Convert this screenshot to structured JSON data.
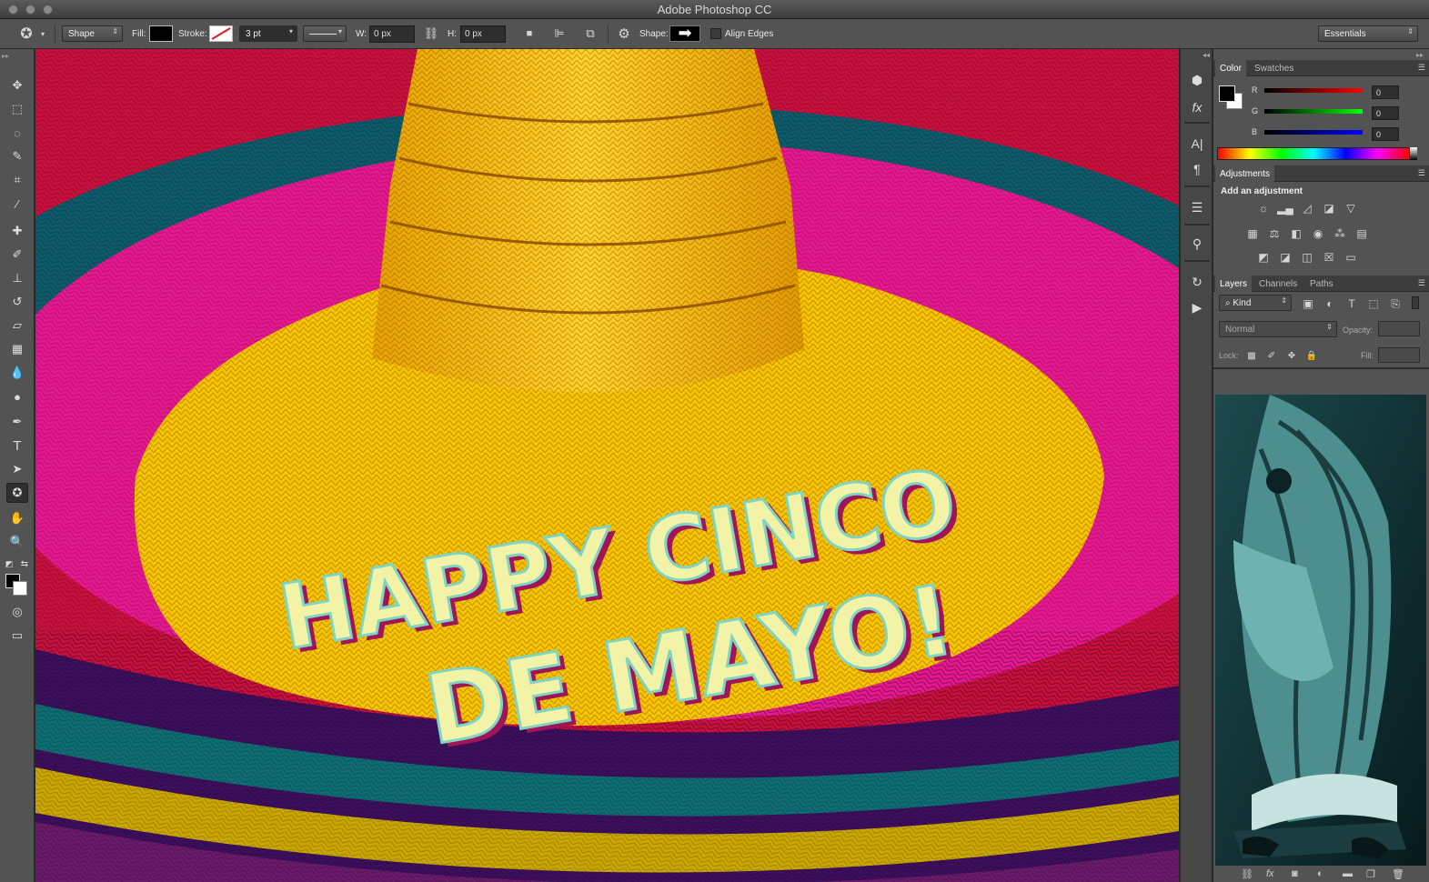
{
  "window": {
    "title": "Adobe Photoshop CC"
  },
  "options_bar": {
    "mode_value": "Shape",
    "fill_label": "Fill:",
    "stroke_label": "Stroke:",
    "stroke_width": "3 pt",
    "w_label": "W:",
    "w_value": "0 px",
    "h_label": "H:",
    "h_value": "0 px",
    "shape_label": "Shape:",
    "align_edges_label": "Align Edges",
    "workspace": "Essentials"
  },
  "tools": [
    "move-tool-icon",
    "marquee-tool-icon",
    "lasso-tool-icon",
    "quick-select-tool-icon",
    "crop-tool-icon",
    "eyedropper-tool-icon",
    "healing-brush-tool-icon",
    "brush-tool-icon",
    "clone-stamp-tool-icon",
    "history-brush-tool-icon",
    "eraser-tool-icon",
    "gradient-tool-icon",
    "blur-tool-icon",
    "dodge-tool-icon",
    "pen-tool-icon",
    "type-tool-icon",
    "path-select-tool-icon",
    "custom-shape-tool-icon",
    "hand-tool-icon",
    "zoom-tool-icon"
  ],
  "canvas": {
    "headline_line1": "HAPPY CINCO",
    "headline_line2": "DE MAYO!"
  },
  "color_panel": {
    "tab_color": "Color",
    "tab_swatches": "Swatches",
    "r_label": "R",
    "g_label": "G",
    "b_label": "B",
    "r_value": "0",
    "g_value": "0",
    "b_value": "0"
  },
  "adjustments_panel": {
    "tab": "Adjustments",
    "heading": "Add an adjustment"
  },
  "layers_panel": {
    "tab_layers": "Layers",
    "tab_channels": "Channels",
    "tab_paths": "Paths",
    "filter_kind": "Kind",
    "blend_mode": "Normal",
    "opacity_label": "Opacity:",
    "lock_label": "Lock:",
    "fill_label": "Fill:"
  }
}
